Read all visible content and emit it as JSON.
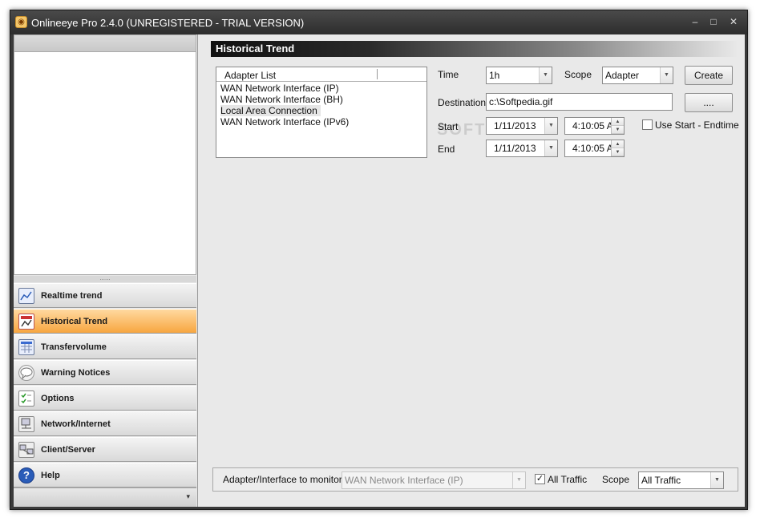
{
  "window": {
    "title": "Onlineeye Pro 2.4.0 (UNREGISTERED - TRIAL VERSION)",
    "controls": {
      "minimize": "–",
      "maximize": "□",
      "close": "✕"
    }
  },
  "sidebar": {
    "items": [
      {
        "label": "Realtime trend",
        "icon": "chart-icon"
      },
      {
        "label": "Historical Trend",
        "icon": "history-chart-icon",
        "active": true
      },
      {
        "label": "Transfervolume",
        "icon": "calendar-grid-icon"
      },
      {
        "label": "Warning Notices",
        "icon": "speech-bubble-icon"
      },
      {
        "label": "Options",
        "icon": "checklist-icon"
      },
      {
        "label": "Network/Internet",
        "icon": "network-icon"
      },
      {
        "label": "Client/Server",
        "icon": "computers-icon"
      },
      {
        "label": "Help",
        "icon": "help-icon"
      }
    ],
    "footer_glyph": "▾",
    "splitter_grip": "......"
  },
  "main": {
    "header_title": "Historical Trend",
    "adapter_list": {
      "header": "Adapter List",
      "items": [
        "WAN Network Interface (IP)",
        "WAN Network Interface (BH)",
        "Local Area Connection",
        "WAN Network Interface (IPv6)"
      ],
      "selected_index": 2
    },
    "form": {
      "time_label": "Time",
      "time_value": "1h",
      "scope_label": "Scope",
      "scope_value": "Adapter",
      "create_button": "Create",
      "destination_label": "Destination",
      "destination_value": "c:\\Softpedia.gif",
      "browse_button": "....",
      "start_label": "Start",
      "start_date": "1/11/2013",
      "start_time": "4:10:05 A",
      "end_label": "End",
      "end_date": "1/11/2013",
      "end_time": "4:10:05 A",
      "use_start_end_label": "Use Start - Endtime",
      "use_start_end_checked": false
    },
    "watermark": "SOFTPEDIA",
    "bottom": {
      "adapter_label": "Adapter/Interface to monitor",
      "adapter_value": "WAN Network Interface (IP)",
      "all_traffic_label": "All Traffic",
      "all_traffic_checked": true,
      "scope_label": "Scope",
      "scope_value": "All Traffic"
    }
  }
}
